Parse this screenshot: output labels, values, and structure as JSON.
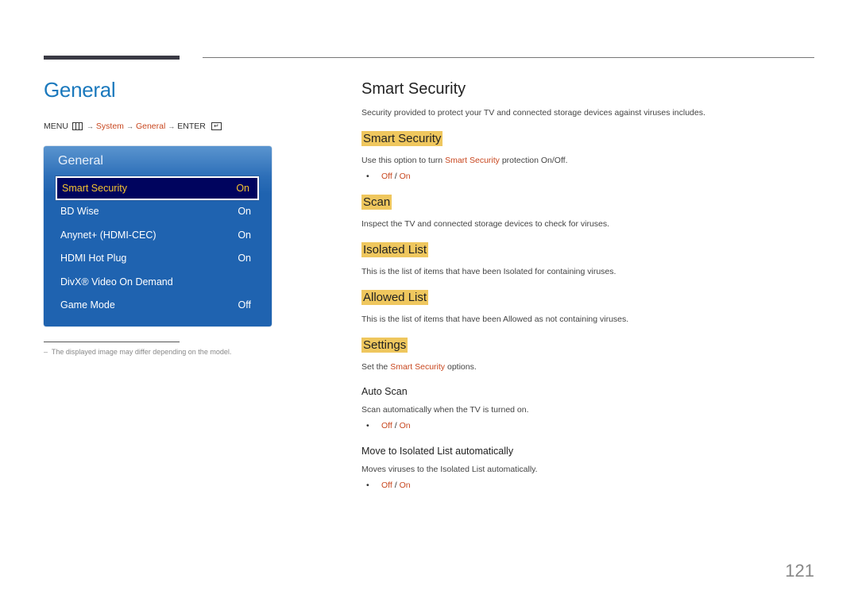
{
  "page": {
    "title": "General",
    "page_number": "121",
    "footnote": "The displayed image may differ depending on the model.",
    "footnote_dash": "–"
  },
  "breadcrumb": {
    "menu": "MENU",
    "menu_icon": "menu-grid-icon",
    "arrow": "→",
    "system": "System",
    "general": "General",
    "enter": "ENTER",
    "enter_icon": "enter-icon",
    "enter_glyph": "↵"
  },
  "osd": {
    "title": "General",
    "items": [
      {
        "label": "Smart Security",
        "value": "On",
        "selected": true
      },
      {
        "label": "BD Wise",
        "value": "On"
      },
      {
        "label": "Anynet+ (HDMI-CEC)",
        "value": "On"
      },
      {
        "label": "HDMI Hot Plug",
        "value": "On"
      },
      {
        "label": "DivX® Video On Demand",
        "value": ""
      },
      {
        "label": "Game Mode",
        "value": "Off"
      }
    ]
  },
  "content": {
    "title": "Smart Security",
    "intro": "Security provided to protect your TV and connected storage devices against viruses includes.",
    "sections": {
      "smart_security": {
        "heading": "Smart Security",
        "desc_before": "Use this option to turn ",
        "desc_link": "Smart Security",
        "desc_after": " protection On/Off.",
        "options": {
          "off": "Off",
          "sep": " / ",
          "on": "On"
        }
      },
      "scan": {
        "heading": "Scan",
        "desc": "Inspect the TV and connected storage devices to check for viruses."
      },
      "isolated_list": {
        "heading": "Isolated List",
        "desc": "This is the list of items that have been Isolated for containing viruses."
      },
      "allowed_list": {
        "heading": "Allowed List",
        "desc": "This is the list of items that have been Allowed as not containing viruses."
      },
      "settings": {
        "heading": "Settings",
        "desc_before": "Set the ",
        "desc_link": "Smart Security",
        "desc_after": " options.",
        "auto_scan": {
          "heading": "Auto Scan",
          "desc": "Scan automatically when the TV is turned on.",
          "options": {
            "off": "Off",
            "sep": " / ",
            "on": "On"
          }
        },
        "move_isolated": {
          "heading": "Move to Isolated List automatically",
          "desc": "Moves viruses to the Isolated List automatically.",
          "options": {
            "off": "Off",
            "sep": " / ",
            "on": "On"
          }
        }
      }
    },
    "bullet": "•"
  },
  "colors": {
    "title_blue": "#1b79bd",
    "highlight_red": "#c8471f",
    "tag_yellow": "#efc75e",
    "osd_blue": "#1f63b0",
    "osd_selected": "#00045e",
    "osd_selected_text": "#f4c430"
  }
}
